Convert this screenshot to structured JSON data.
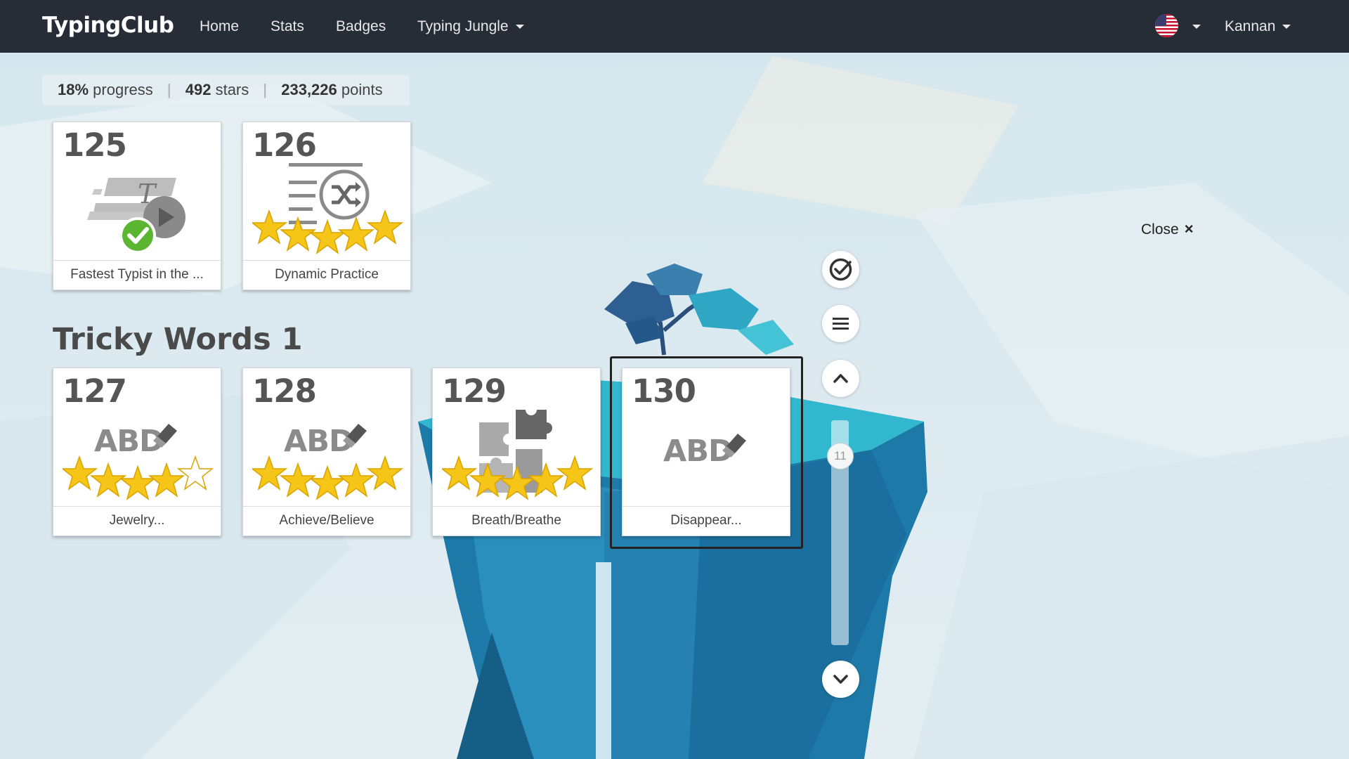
{
  "nav": {
    "brand": "TypingClub",
    "links": [
      "Home",
      "Stats",
      "Badges"
    ],
    "dropdown_label": "Typing Jungle",
    "user": "Kannan",
    "flag_icon": "us-flag-icon"
  },
  "stats": {
    "progress_value": "18%",
    "progress_label": "progress",
    "stars_value": "492",
    "stars_label": "stars",
    "points_value": "233,226",
    "points_label": "points"
  },
  "section": {
    "title": "Tricky Words 1"
  },
  "lessons": [
    {
      "number": "125",
      "label": "Fastest Typist in the ...",
      "icon": "speed-typing-video-icon",
      "completed": true
    },
    {
      "number": "126",
      "label": "Dynamic Practice",
      "icon": "shuffle-practice-icon",
      "stars": 5
    },
    {
      "number": "127",
      "label": "Jewelry...",
      "icon": "abd-eraser-icon",
      "stars": 4
    },
    {
      "number": "128",
      "label": "Achieve/Believe",
      "icon": "abd-eraser-icon",
      "stars": 5
    },
    {
      "number": "129",
      "label": "Breath/Breathe",
      "icon": "puzzle-icon",
      "stars": 5
    },
    {
      "number": "130",
      "label": "Disappear...",
      "icon": "abd-eraser-icon",
      "stars": 0,
      "selected": true
    }
  ],
  "abd_text": "ABD",
  "controls": {
    "slider_value": "11",
    "close_label": "Close",
    "close_symbol": "×"
  },
  "colors": {
    "navbar": "#262d36",
    "star_fill": "#f5c518",
    "check_green": "#5cb531"
  }
}
